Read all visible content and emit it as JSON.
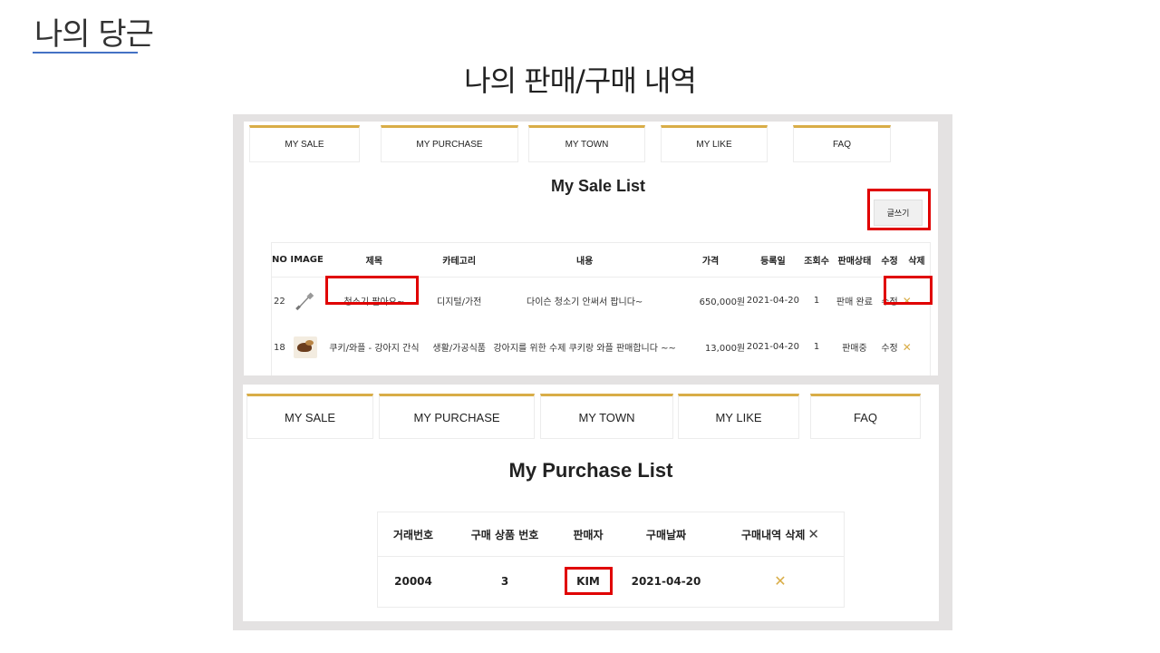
{
  "slide": {
    "title": "나의 당근",
    "subtitle": "나의 판매/구매 내역"
  },
  "colors": {
    "accent": "#d9ad47",
    "highlight": "#e00000",
    "title_underline": "#4472c4"
  },
  "tabs": [
    "MY SALE",
    "MY PURCHASE",
    "MY TOWN",
    "MY LIKE",
    "FAQ"
  ],
  "sale": {
    "title": "My Sale List",
    "write_button": "글쓰기",
    "columns": [
      "NO IMAGE",
      "제목",
      "카테고리",
      "내용",
      "가격",
      "등록일",
      "조회수",
      "판매상태",
      "수정",
      "삭제"
    ],
    "rows": [
      {
        "no": "22",
        "image": "sweeper-icon",
        "title": "청소기 팔아요~",
        "category": "디지털/가전",
        "content": "다이슨 청소기 안써서 팝니다~",
        "price": "650,000원",
        "date": "2021-04-20",
        "views": "1",
        "status": "판매 완료",
        "edit": "수정",
        "delete": "✕"
      },
      {
        "no": "18",
        "image": "cookie-photo",
        "title": "쿠키/와플 - 강아지 간식",
        "category": "생활/가공식품",
        "content": "강아지를 위한 수제 쿠키랑 와플 판매합니다 ~~",
        "price": "13,000원",
        "date": "2021-04-20",
        "views": "1",
        "status": "판매중",
        "edit": "수정",
        "delete": "✕"
      }
    ]
  },
  "purchase": {
    "title": "My Purchase List",
    "columns": [
      "거래번호",
      "구매 상품 번호",
      "판매자",
      "구매날짜",
      "구매내역 삭제"
    ],
    "delete_header_icon": "✕",
    "rows": [
      {
        "trade_no": "20004",
        "product_no": "3",
        "seller": "KIM",
        "date": "2021-04-20",
        "delete": "✕"
      }
    ]
  }
}
